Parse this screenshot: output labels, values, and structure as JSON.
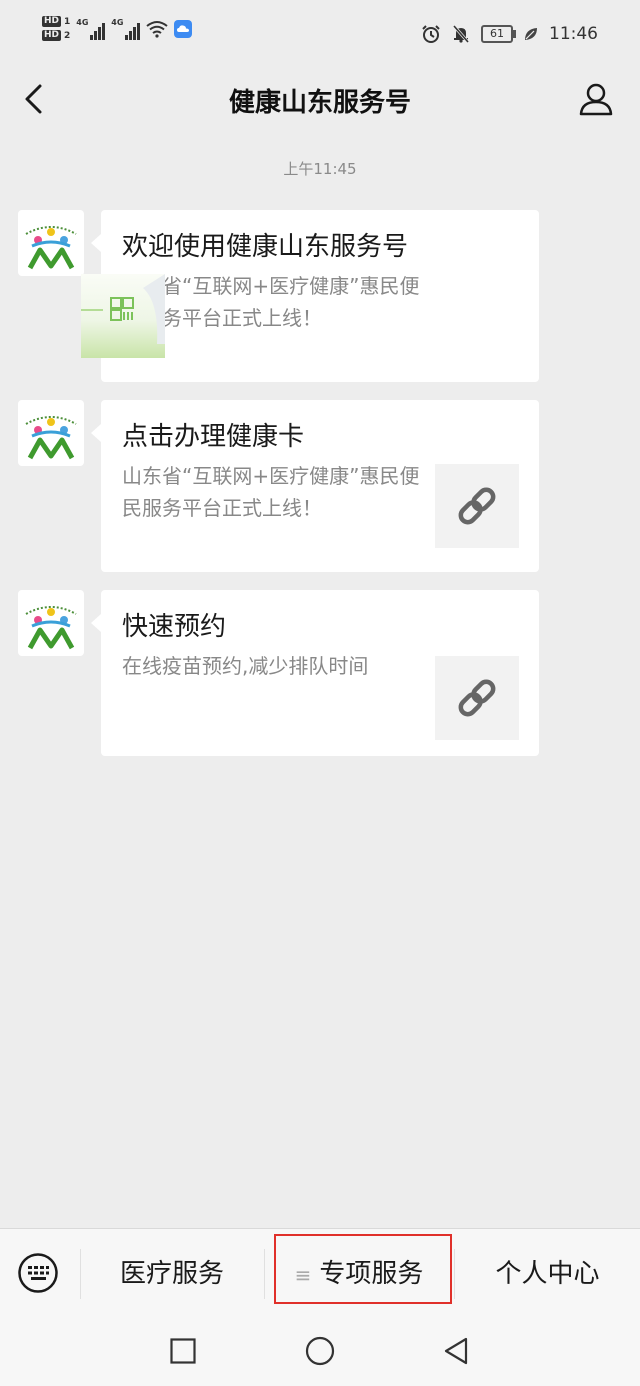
{
  "status_bar": {
    "hd1": "HD",
    "hd1_num": "1",
    "hd2": "HD",
    "hd2_num": "2",
    "net1": "4G",
    "net2": "4G",
    "battery": "61",
    "time": "11:46"
  },
  "nav": {
    "title": "健康山东服务号"
  },
  "timestamp": "上午11:45",
  "messages": [
    {
      "title": "欢迎使用健康山东服务号",
      "desc": "山东省“互联网+医疗健康”惠民便民服务平台正式上线！",
      "thumb": "image"
    },
    {
      "title": "点击办理健康卡",
      "desc": "山东省“互联网+医疗健康”惠民便民服务平台正式上线！",
      "thumb": "link-icon"
    },
    {
      "title": "快速预约",
      "desc": "在线疫苗预约,减少排队时间",
      "thumb": "link-icon"
    }
  ],
  "menu": {
    "item1": "医疗服务",
    "item2_icon": "≡",
    "item2": "专项服务",
    "item3": "个人中心"
  },
  "colors": {
    "background": "#ededed",
    "card": "#ffffff",
    "highlight_border": "#e0302a"
  }
}
